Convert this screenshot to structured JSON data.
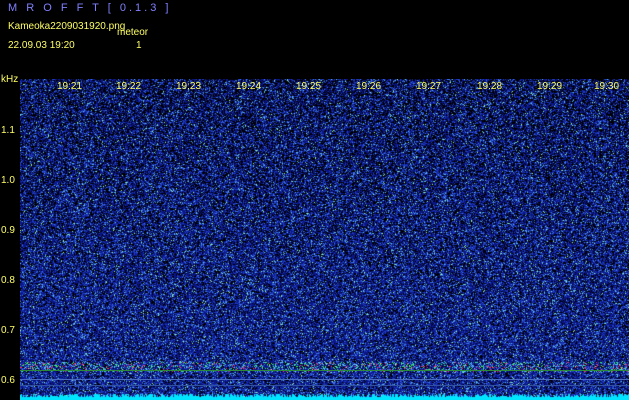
{
  "app": {
    "title": "M R O F F T  [ 0.1.3 ]"
  },
  "header": {
    "file_name": "Kameoka2209031920.png",
    "event_label": "meteor",
    "datetime": "22.09.03  19:20",
    "event_count": "1"
  },
  "spectrogram": {
    "unit_label": "kHz",
    "y_ticks": [
      "1.1",
      "1.0",
      "0.9",
      "0.8",
      "0.7",
      "0.6"
    ],
    "x_ticks": [
      "19:21",
      "19:22",
      "19:23",
      "19:24",
      "19:25",
      "19:26",
      "19:27",
      "19:28",
      "19:29",
      "19:30"
    ],
    "colors": {
      "background": "#000000",
      "noise_low": "#0a1a9a",
      "noise_high": "#5aa0ff",
      "meteor_echo": "#ff3366",
      "carrier": "#33ff66",
      "level_bar": "#00e5ff",
      "labels": "#ffff66",
      "title": "#8080ff"
    }
  }
}
